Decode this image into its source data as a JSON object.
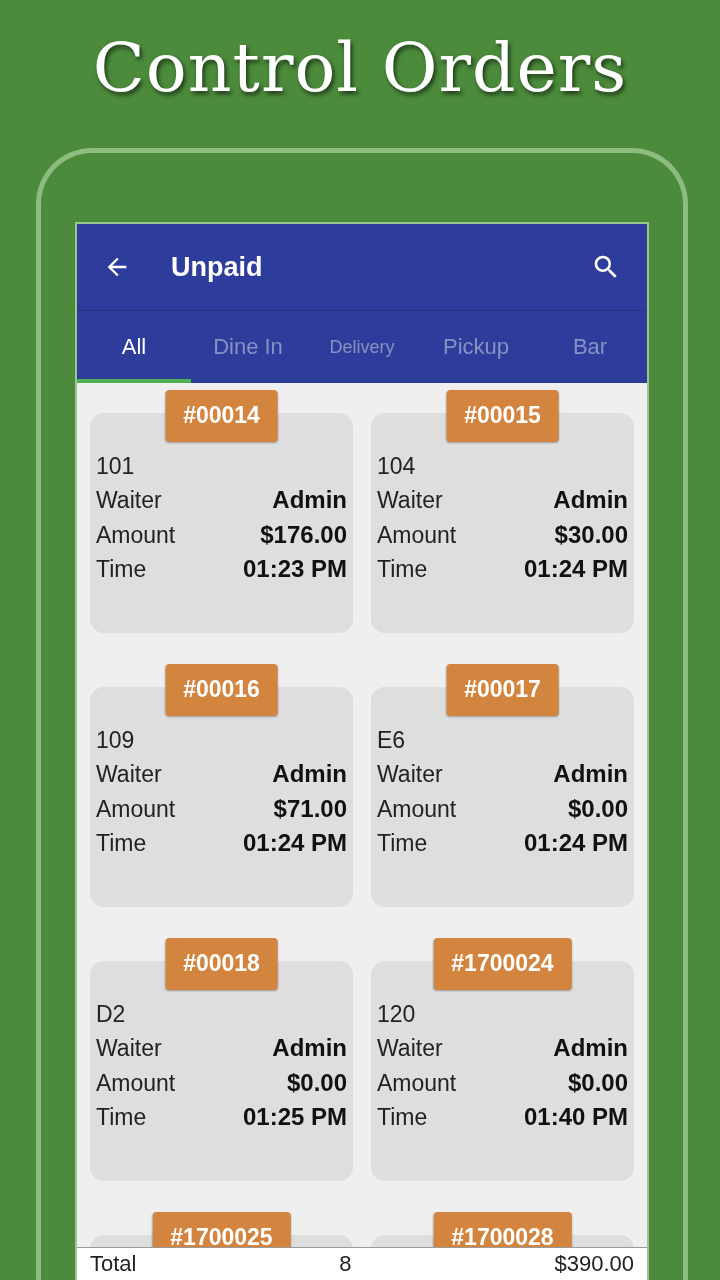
{
  "headline": "Control Orders",
  "app_bar": {
    "title": "Unpaid"
  },
  "tabs": [
    {
      "label": "All",
      "selected": true
    },
    {
      "label": "Dine In",
      "selected": false
    },
    {
      "label": "Delivery",
      "selected": false
    },
    {
      "label": "Pickup",
      "selected": false
    },
    {
      "label": "Bar",
      "selected": false
    }
  ],
  "orders": [
    {
      "number": "#00014",
      "table": "101",
      "rows": [
        {
          "label": "Waiter",
          "value": "Admin"
        },
        {
          "label": "Amount",
          "value": "$176.00"
        },
        {
          "label": "Time",
          "value": "01:23 PM"
        }
      ]
    },
    {
      "number": "#00015",
      "table": "104",
      "rows": [
        {
          "label": "Waiter",
          "value": "Admin"
        },
        {
          "label": "Amount",
          "value": "$30.00"
        },
        {
          "label": "Time",
          "value": "01:24 PM"
        }
      ]
    },
    {
      "number": "#00016",
      "table": "109",
      "rows": [
        {
          "label": "Waiter",
          "value": "Admin"
        },
        {
          "label": "Amount",
          "value": "$71.00"
        },
        {
          "label": "Time",
          "value": "01:24 PM"
        }
      ]
    },
    {
      "number": "#00017",
      "table": "E6",
      "rows": [
        {
          "label": "Waiter",
          "value": "Admin"
        },
        {
          "label": "Amount",
          "value": "$0.00"
        },
        {
          "label": "Time",
          "value": "01:24 PM"
        }
      ]
    },
    {
      "number": "#00018",
      "table": "D2",
      "rows": [
        {
          "label": "Waiter",
          "value": "Admin"
        },
        {
          "label": "Amount",
          "value": "$0.00"
        },
        {
          "label": "Time",
          "value": "01:25 PM"
        }
      ]
    },
    {
      "number": "#1700024",
      "table": "120",
      "rows": [
        {
          "label": "Waiter",
          "value": "Admin"
        },
        {
          "label": "Amount",
          "value": "$0.00"
        },
        {
          "label": "Time",
          "value": "01:40 PM"
        }
      ]
    },
    {
      "number": "#1700025"
    },
    {
      "number": "#1700028"
    }
  ],
  "total": {
    "label": "Total",
    "count": "8",
    "amount": "$390.00"
  }
}
